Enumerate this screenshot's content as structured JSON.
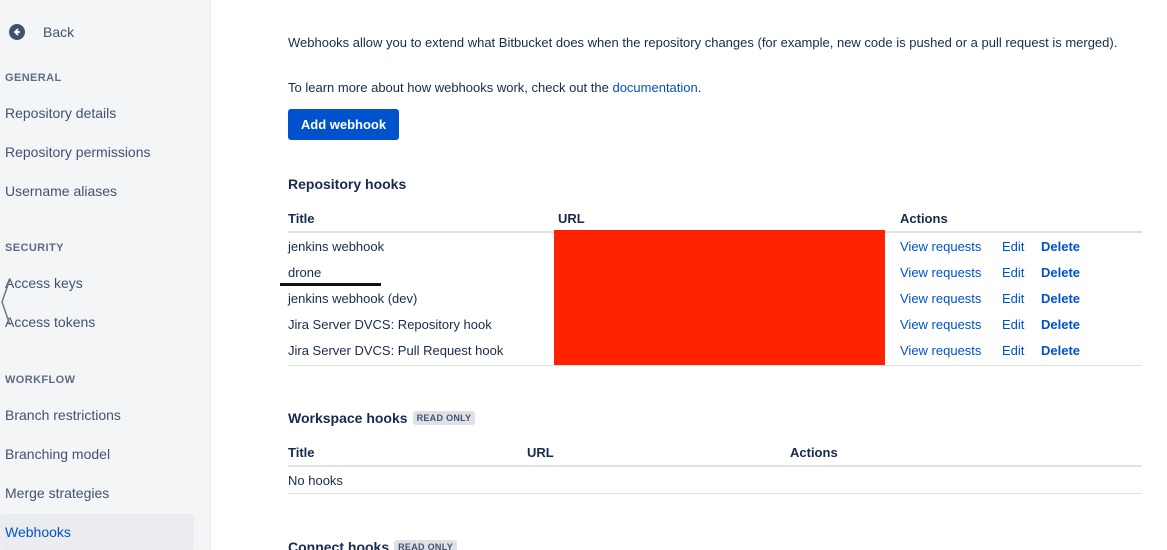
{
  "sidebar": {
    "back_label": "Back",
    "sections": {
      "general": "GENERAL",
      "security": "SECURITY",
      "workflow": "WORKFLOW"
    },
    "items": {
      "repository_details": "Repository details",
      "repository_permissions": "Repository permissions",
      "username_aliases": "Username aliases",
      "access_keys": "Access keys",
      "access_tokens": "Access tokens",
      "branch_restrictions": "Branch restrictions",
      "branching_model": "Branching model",
      "merge_strategies": "Merge strategies",
      "webhooks": "Webhooks"
    }
  },
  "main": {
    "intro": "Webhooks allow you to extend what Bitbucket does when the repository changes (for example, new code is pushed or a pull request is merged).",
    "learn_prefix": "To learn more about how webhooks work, check out the ",
    "learn_link": "documentation",
    "learn_suffix": ".",
    "add_button": "Add webhook",
    "repo_hooks": {
      "title": "Repository hooks",
      "headers": {
        "title": "Title",
        "url": "URL",
        "actions": "Actions"
      },
      "rows": [
        {
          "title": "jenkins webhook"
        },
        {
          "title": "drone"
        },
        {
          "title": "jenkins webhook (dev)"
        },
        {
          "title": "Jira Server DVCS: Repository hook"
        },
        {
          "title": "Jira Server DVCS: Pull Request hook"
        }
      ],
      "actions": {
        "view": "View requests",
        "edit": "Edit",
        "delete": "Delete"
      }
    },
    "workspace_hooks": {
      "title": "Workspace hooks",
      "badge": "READ ONLY",
      "headers": {
        "title": "Title",
        "url": "URL",
        "actions": "Actions"
      },
      "empty": "No hooks"
    },
    "connect_hooks": {
      "title": "Connect hooks",
      "badge": "READ ONLY"
    }
  },
  "colors": {
    "primary": "#0052cc",
    "redaction": "#ff2200",
    "sidebar_bg": "#f4f5f7"
  }
}
